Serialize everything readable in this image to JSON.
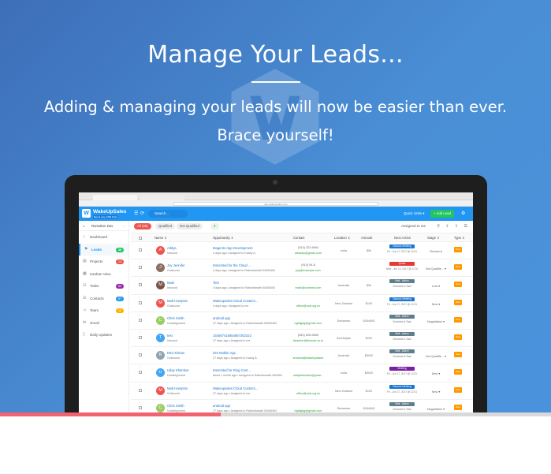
{
  "hero": {
    "title": "Manage Your Leads...",
    "subtitle_line1": "Adding & managing your leads will now be easier than ever.",
    "subtitle_line2": "Brace yourself!",
    "progress_fraction": 0.4
  },
  "browser": {
    "url": "app.wakeupsales.com"
  },
  "app": {
    "logo_letter": "W",
    "brand": "WakeUpSales",
    "tagline": "Best & easy CRM Suite",
    "search_placeholder": "Search...",
    "quick_units": "Quick Units ▾",
    "add_lead": "+ Add Lead"
  },
  "sidebar": {
    "user": "Ramalton Das",
    "items": [
      {
        "label": "Dashboard",
        "icon": "⌂",
        "badge": "",
        "color": ""
      },
      {
        "label": "Leads",
        "icon": "⚑",
        "badge": "35",
        "color": "#22c55e"
      },
      {
        "label": "Projects",
        "icon": "▤",
        "badge": "13",
        "color": "#ef5350"
      },
      {
        "label": "Kanban View",
        "icon": "▦",
        "badge": "",
        "color": ""
      },
      {
        "label": "Tasks",
        "icon": "☑",
        "badge": "60",
        "color": "#9c27b0"
      },
      {
        "label": "Contacts",
        "icon": "☰",
        "badge": "87",
        "color": "#2196f3"
      },
      {
        "label": "Team",
        "icon": "☺",
        "badge": "4",
        "color": "#ffb300"
      },
      {
        "label": "Gmail",
        "icon": "✉",
        "badge": "",
        "color": ""
      },
      {
        "label": "Daily Updates",
        "icon": "▯",
        "badge": "",
        "color": ""
      }
    ]
  },
  "filters": {
    "all": "All (35)",
    "qualified": "Qualified",
    "not_qualified": "Not Qualified",
    "assigned": "Assigned to me",
    "tools": "⚲ ⇪ ⇩ ☰"
  },
  "columns": [
    "Name ⇕",
    "Opportunity ⇕",
    "Contact",
    "Location ⇕",
    "Amount",
    "Next Action",
    "Stage ⇕",
    "Type ⇕"
  ],
  "rows": [
    {
      "initial": "A",
      "av": "#ef5350",
      "name": "Aditya",
      "src": "Inbound",
      "opp": "Magento App Development",
      "meta": "4 days ago  • Assigned to Kasby A.",
      "phone": "(510) 222-6664",
      "email": "aikasby@gmail.com",
      "loc": "India",
      "amt": "$5k",
      "na": "Discuss Meeting",
      "nac": "#1976d2",
      "nad": "Fri - Jun 17, 2017 @ 12:31",
      "stage": "Review ▾",
      "type": "New"
    },
    {
      "initial": "J",
      "av": "#8d6e63",
      "name": "Joy Jennifer",
      "src": "Outbound",
      "opp": "Interested for the Cloud ...",
      "meta": "4 days ago  • Assigned to Rabindranath 54006454",
      "phone": "(510) 54-8",
      "email": "joy@example.com",
      "loc": "",
      "amt": "",
      "na": "Quote",
      "nac": "#e53935",
      "nad": "Wed - Jun 14, 2017 @ 12:31",
      "stage": "Not Qualifie... ▾",
      "type": "New"
    },
    {
      "initial": "M",
      "av": "#795548",
      "name": "Mark",
      "src": "Inbound",
      "opp": "Test",
      "meta": "4 days ago  • Assigned to Rabindranath 54006454",
      "phone": "",
      "email": "mark@comnet.com",
      "loc": "Australia",
      "amt": "$5k",
      "na": "Mail - Action",
      "nac": "#607d8b",
      "nad": "Schedule A Task",
      "stage": "Lost ▾",
      "type": "New"
    },
    {
      "initial": "M",
      "av": "#ef5350",
      "name": "Matt Hampton",
      "src": "Outbound",
      "opp": "Wakeupsales Cloud Customi...",
      "meta": "4 days ago  • Assigned to me",
      "phone": "",
      "email": "office@cali.org.nz",
      "loc": "New Zealand",
      "amt": "$100",
      "na": "Discuss Meeting",
      "nac": "#1976d2",
      "nad": "Fri - Jun 17, 2017 @ 12:31",
      "stage": "New ▾",
      "type": "New"
    },
    {
      "initial": "C",
      "av": "#9ccc65",
      "name": "Chris Smith",
      "src": "Uncategorized",
      "opp": "android app",
      "meta": "27 days ago  • Assigned to Rabindranath 54006454",
      "phone": "",
      "email": "rigdfgdg@gmail.com",
      "loc": "Bahamas",
      "amt": "$454845",
      "na": "Mail - Action",
      "nac": "#607d8b",
      "nad": "Schedule A Task",
      "stage": "Negotiation ▾",
      "type": "New"
    },
    {
      "initial": "T",
      "av": "#42a5f5",
      "name": "test",
      "src": "Inbound",
      "opp": "154567415654667352322",
      "meta": "27 days ago  • Assigned to me",
      "phone": "(840) 626-5565",
      "email": "bbasher@bbmob.co.in",
      "loc": "Azerbaijan",
      "amt": "$200",
      "na": "Mail - Action",
      "nac": "#607d8b",
      "nad": "Schedule A Task",
      "stage": "",
      "type": "New"
    },
    {
      "initial": "R",
      "av": "#90a4ae",
      "name": "Ravi Kishan",
      "src": "Outbound",
      "opp": "iOS Mobile App",
      "meta": "27 days ago  • Assigned to Kasby A.",
      "phone": "",
      "email": "smbwol@wakeupsales",
      "loc": "Australia",
      "amt": "$5000",
      "na": "Mail - Action",
      "nac": "#607d8b",
      "nad": "Schedule A Task",
      "stage": "Not Qualifie... ▾",
      "type": "New"
    },
    {
      "initial": "U",
      "av": "#42a5f5",
      "name": "Uday Khamker",
      "src": "Uncategorized",
      "opp": "Interested for Ring Cont...",
      "meta": "about 1 month ago  • Assigned to Rabindranath 54006454",
      "phone": "",
      "email": "udaykhamkar@gmai...",
      "loc": "India",
      "amt": "$5000",
      "na": "Meeting",
      "nac": "#7b1fa2",
      "nad": "Fri - Jun 17, 2017 @ 12:31",
      "stage": "New ▾",
      "type": "New"
    },
    {
      "initial": "M",
      "av": "#ef5350",
      "name": "Matt Hampton",
      "src": "Outbound",
      "opp": "Wakeupsales Cloud Customi...",
      "meta": "27 days ago  • Assigned to me",
      "phone": "",
      "email": "office@cali.org.nz",
      "loc": "New Zealand",
      "amt": "$100",
      "na": "Discuss Meeting",
      "nac": "#1976d2",
      "nad": "Fri - Jun 17, 2017 @ 12:31",
      "stage": "New ▾",
      "type": "New"
    },
    {
      "initial": "C",
      "av": "#9ccc65",
      "name": "Chris Smith",
      "src": "Uncategorized",
      "opp": "android app",
      "meta": "27 days ago  • Assigned to Rabindranath 54006454",
      "phone": "",
      "email": "rigdfgdg@gmail.com",
      "loc": "Bahamas",
      "amt": "$454845",
      "na": "Mail - Action",
      "nac": "#607d8b",
      "nad": "Schedule A Task",
      "stage": "Negotiation ▾",
      "type": "New"
    }
  ]
}
